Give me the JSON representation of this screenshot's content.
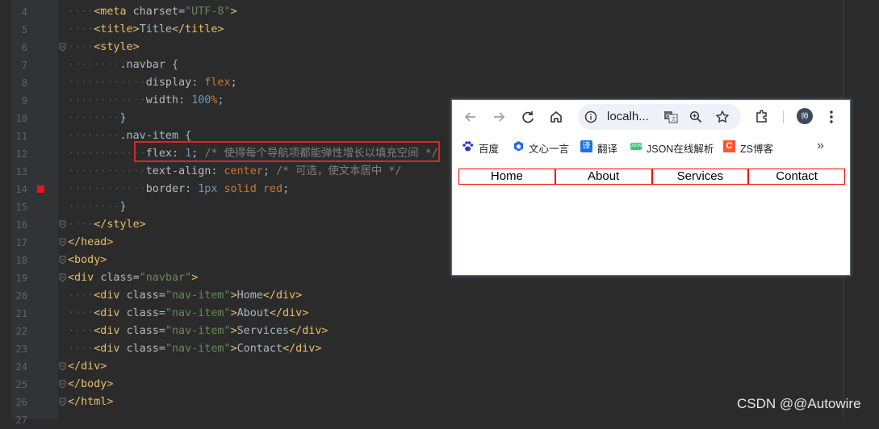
{
  "editor": {
    "line_numbers": [
      "4",
      "5",
      "6",
      "7",
      "8",
      "9",
      "10",
      "11",
      "12",
      "13",
      "14",
      "15",
      "16",
      "17",
      "18",
      "19",
      "20",
      "21",
      "22",
      "23",
      "24",
      "25",
      "26",
      "27"
    ],
    "lines": [
      {
        "t": "<meta charset=\"UTF-8\">"
      },
      {
        "t": "<title>Title</title>"
      },
      {
        "t": "<style>"
      },
      {
        "t": ".navbar {"
      },
      {
        "t": "display: flex;"
      },
      {
        "t": "width: 100%;"
      },
      {
        "t": "}"
      },
      {
        "t": ".nav-item {"
      },
      {
        "t": "flex: 1; /* 使得每个导航项都能弹性增长以填充空间 */"
      },
      {
        "t": "text-align: center; /* 可选，使文本居中 */"
      },
      {
        "t": "border: 1px solid red;"
      },
      {
        "t": "}"
      },
      {
        "t": "</style>"
      },
      {
        "t": "</head>"
      },
      {
        "t": "<body>"
      },
      {
        "t": "<div class=\"navbar\">"
      },
      {
        "t": "<div class=\"nav-item\">Home</div>"
      },
      {
        "t": "<div class=\"nav-item\">About</div>"
      },
      {
        "t": "<div class=\"nav-item\">Services</div>"
      },
      {
        "t": "<div class=\"nav-item\">Contact</div>"
      },
      {
        "t": "</div>"
      },
      {
        "t": "</body>"
      },
      {
        "t": "</html>"
      }
    ],
    "tokens": {
      "l4": [
        "<meta ",
        "charset",
        "=",
        "\"UTF-8\"",
        ">"
      ],
      "l5": [
        "<title>",
        "Title",
        "</title>"
      ],
      "l6": [
        "<style>"
      ],
      "l7": [
        ".navbar ",
        "{"
      ],
      "l8": [
        "display",
        ": ",
        "flex",
        ";"
      ],
      "l9": [
        "width",
        ": ",
        "100",
        "%",
        ";"
      ],
      "l10": [
        "}"
      ],
      "l11": [
        ".nav-item ",
        "{"
      ],
      "l12": [
        "flex",
        ": ",
        "1",
        "; ",
        "/* 使得每个导航项都能弹性增长以填充空间 */"
      ],
      "l13": [
        "text-align",
        ": ",
        "center",
        "; ",
        "/* 可选，使文本居中 */"
      ],
      "l14": [
        "border",
        ": ",
        "1px",
        " solid red",
        ";"
      ],
      "l15": [
        "}"
      ],
      "l16": [
        "</style>"
      ],
      "l17": [
        "</head>"
      ],
      "l18": [
        "<body>"
      ],
      "l19": [
        "<div ",
        "class",
        "=",
        "\"navbar\"",
        ">"
      ],
      "l20": [
        "<div ",
        "class",
        "=",
        "\"nav-item\"",
        ">",
        "Home",
        "</div>"
      ],
      "l21": [
        "<div ",
        "class",
        "=",
        "\"nav-item\"",
        ">",
        "About",
        "</div>"
      ],
      "l22": [
        "<div ",
        "class",
        "=",
        "\"nav-item\"",
        ">",
        "Services",
        "</div>"
      ],
      "l23": [
        "<div ",
        "class",
        "=",
        "\"nav-item\"",
        ">",
        "Contact",
        "</div>"
      ],
      "l24": [
        "</div>"
      ],
      "l25": [
        "</body>"
      ],
      "l26": [
        "</html>"
      ]
    }
  },
  "browser": {
    "url": "localh...",
    "avatar_text": "帅",
    "bookmarks": [
      {
        "label": "百度",
        "icon": "baidu-paw-icon",
        "color": "#2932e1"
      },
      {
        "label": "文心一言",
        "icon": "wenxin-cube-icon",
        "color": "#2468f2"
      },
      {
        "label": "翻译",
        "icon": "translate-icon",
        "color": "#1a73e8",
        "icon_text": "译"
      },
      {
        "label": "JSON在线解析",
        "icon": "json-icon",
        "color": "#2ecc71",
        "icon_text": "JSON"
      },
      {
        "label": "ZS博客",
        "icon": "csdn-c-icon",
        "color": "#fc5531",
        "icon_text": "C"
      }
    ],
    "more_label": "»",
    "nav_items": [
      "Home",
      "About",
      "Services",
      "Contact"
    ]
  },
  "watermark": "CSDN @@Autowire",
  "colors": {
    "editor_bg": "#2b2b2b",
    "gutter_bg": "#313335",
    "highlight_border": "#d9262c",
    "breakpoint": "#e8151b",
    "nav_border": "red"
  }
}
